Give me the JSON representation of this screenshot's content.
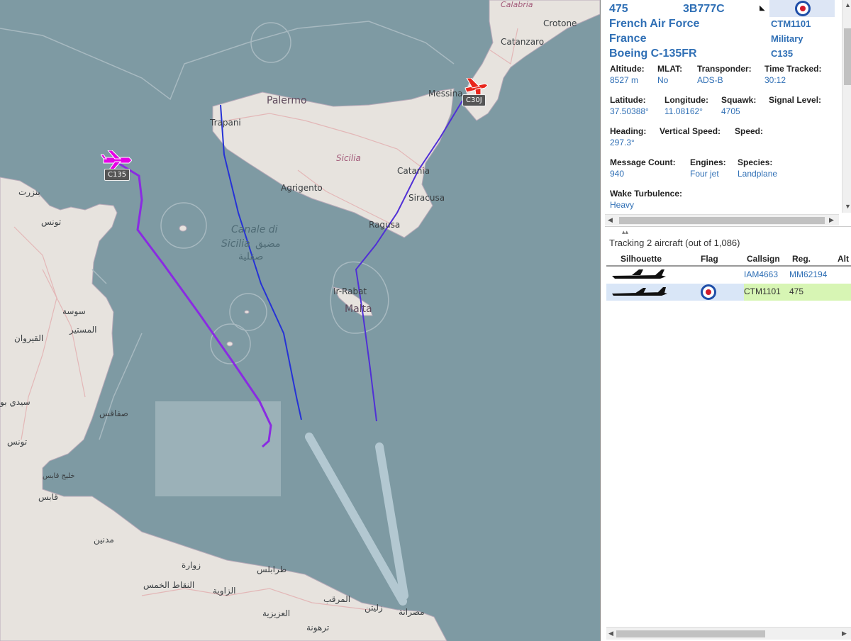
{
  "map": {
    "labels": {
      "calabria": "Calabria",
      "crotone": "Crotone",
      "catanzaro": "Catanzaro",
      "palermo": "Palermo",
      "trapani": "Trapani",
      "messina": "Messina",
      "sicilia": "Sicilia",
      "catania": "Catania",
      "agrigento": "Agrigento",
      "siracusa": "Siracusa",
      "ragusa": "Ragusa",
      "canale_di": "Canale di",
      "sicilia_it": "Sicilia",
      "sea_ar1": "مضيق",
      "sea_ar2": "صقلية",
      "ir_rabat": "Ir-Rabat",
      "malta": "Malta",
      "bizerte": "بنزرت",
      "tunis": "تونس",
      "sousse": "سوسة",
      "monastir": "المستير",
      "kairouan": "القيروان",
      "sfax": "صفاقس",
      "sidi": "سيدي بو",
      "tunis2": "تونس",
      "gulf_gabes": "خليج قابس",
      "gabes": "قابس",
      "medenine": "مدنين",
      "zuwara": "زوارة",
      "tripoli": "طرابلس",
      "zawiya": "الزاوية",
      "nuqat": "النقاط الخمس",
      "aziziya": "العزيزية",
      "tarhuna": "ترهونة",
      "marqab": "المرقب",
      "zliten": "زليتن",
      "misrata": "مصراتة"
    },
    "aircraft": [
      {
        "tag": "C135",
        "color": "#e600e6",
        "track_color": "#7a1fd6"
      },
      {
        "tag": "C30J",
        "color": "#e8261c",
        "track_color": "#5b30d6"
      }
    ]
  },
  "selected": {
    "reg": "475",
    "icao": "3B777C",
    "operator": "French Air Force",
    "country": "France",
    "type": "Boeing C-135FR",
    "callsign": "CTM1101",
    "category": "Military",
    "typecode": "C135",
    "fields": [
      {
        "label": "Altitude:",
        "value": "8527 m"
      },
      {
        "label": "MLAT:",
        "value": "No"
      },
      {
        "label": "Transponder:",
        "value": "ADS-B"
      },
      {
        "label": "Time Tracked:",
        "value": "30:12"
      },
      {
        "label": "Latitude:",
        "value": "37.50388°"
      },
      {
        "label": "Longitude:",
        "value": "11.08162°"
      },
      {
        "label": "Squawk:",
        "value": "4705"
      },
      {
        "label": "Signal Level:",
        "value": ""
      },
      {
        "label": "Heading:",
        "value": "297.3°"
      },
      {
        "label": "Vertical Speed:",
        "value": ""
      },
      {
        "label": "Speed:",
        "value": ""
      },
      {
        "label": "Message Count:",
        "value": "940"
      },
      {
        "label": "Engines:",
        "value": "Four jet"
      },
      {
        "label": "Species:",
        "value": "Landplane"
      },
      {
        "label": "Wake Turbulence:",
        "value": "Heavy"
      }
    ]
  },
  "list": {
    "tracking": "Tracking 2 aircraft (out of 1,086)",
    "columns": [
      "Silhouette",
      "Flag",
      "Callsign",
      "Reg.",
      "Alt"
    ],
    "rows": [
      {
        "callsign": "IAM4663",
        "reg": "MM62194"
      },
      {
        "callsign": "CTM1101",
        "reg": "475"
      }
    ]
  },
  "colors": {
    "sea": "#7e9aa3",
    "land": "#e7e3de",
    "accent": "#2f6fb5",
    "selected_row": "#d9e6f7",
    "callsign_highlight": "#d7f5b4"
  }
}
